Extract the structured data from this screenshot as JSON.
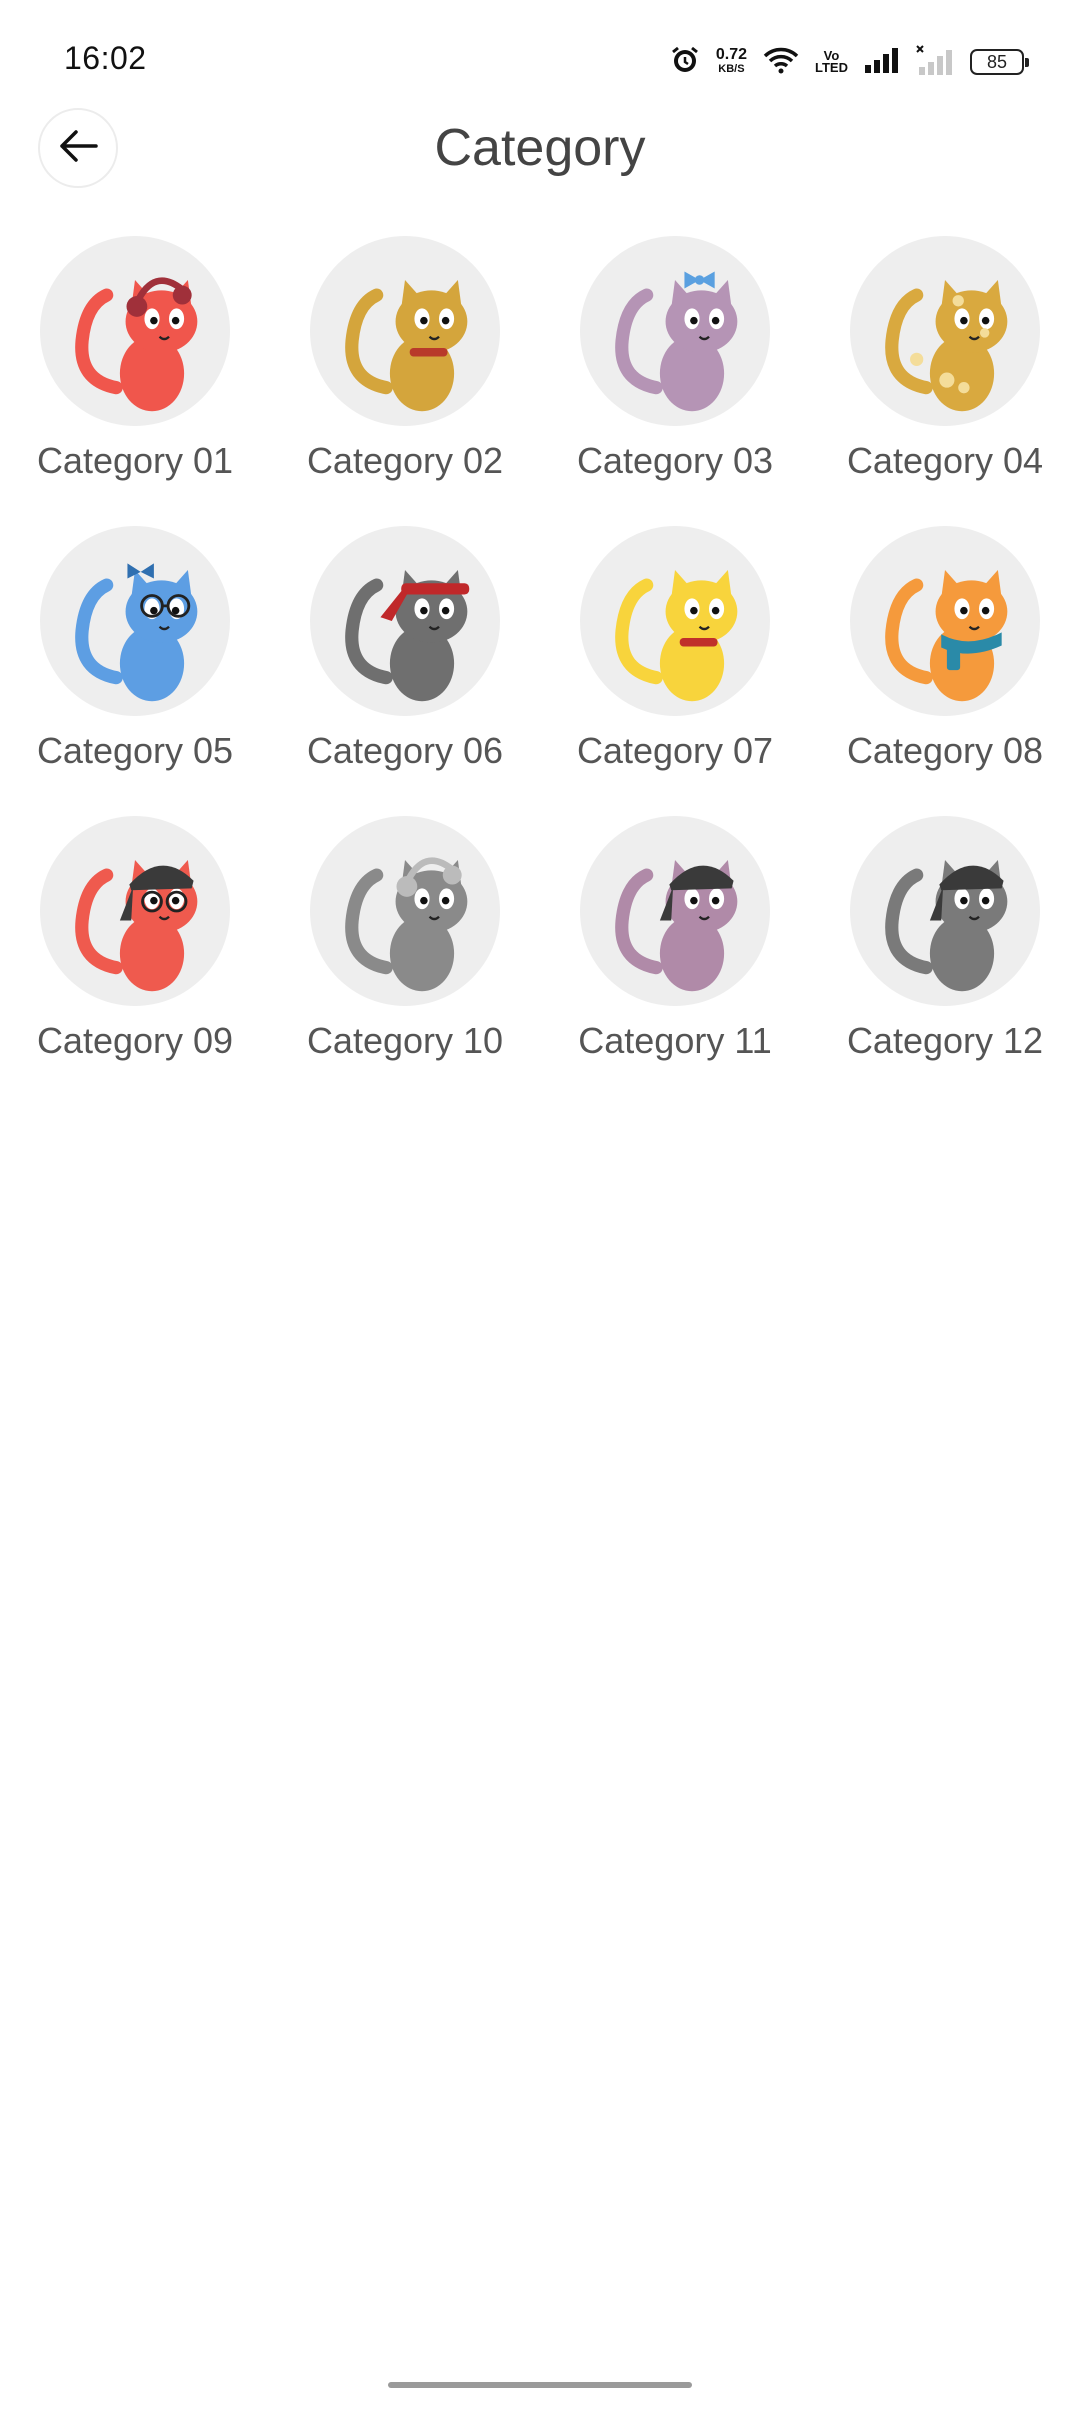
{
  "status_bar": {
    "time": "16:02",
    "net_speed_value": "0.72",
    "net_speed_unit": "KB/S",
    "volte_line1": "Vo",
    "volte_line2": "LTED",
    "battery_level": "85",
    "icons": [
      "alarm-icon",
      "wifi-icon",
      "signal-icon",
      "signal-no-service-icon",
      "battery-icon"
    ]
  },
  "header": {
    "title": "Category",
    "back_icon": "arrow-left-icon"
  },
  "categories": [
    {
      "label": "Category 01",
      "color": "#f0564c",
      "accessory": "headphones",
      "accessory_color": "#a0303a"
    },
    {
      "label": "Category 02",
      "color": "#d4a53c",
      "accessory": "collar",
      "accessory_color": "#b83a2a"
    },
    {
      "label": "Category 03",
      "color": "#b594b5",
      "accessory": "bow",
      "accessory_color": "#5aa0e0"
    },
    {
      "label": "Category 04",
      "color": "#d9a93f",
      "accessory": "spots",
      "accessory_color": "#f4dd9a"
    },
    {
      "label": "Category 05",
      "color": "#5d9ee3",
      "accessory": "glasses-bow",
      "accessory_color": "#2f6fb0"
    },
    {
      "label": "Category 06",
      "color": "#6f6f6f",
      "accessory": "headband",
      "accessory_color": "#c0282a"
    },
    {
      "label": "Category 07",
      "color": "#f8d43c",
      "accessory": "collar",
      "accessory_color": "#c0302a"
    },
    {
      "label": "Category 08",
      "color": "#f59a3c",
      "accessory": "scarf",
      "accessory_color": "#2a8aa8"
    },
    {
      "label": "Category 09",
      "color": "#ef5a4e",
      "accessory": "bandana-glasses",
      "accessory_color": "#3a3a3a"
    },
    {
      "label": "Category 10",
      "color": "#8a8a8a",
      "accessory": "headphones",
      "accessory_color": "#bbbbbb"
    },
    {
      "label": "Category 11",
      "color": "#b08aa8",
      "accessory": "bandana",
      "accessory_color": "#3a3a3a"
    },
    {
      "label": "Category 12",
      "color": "#7a7a7a",
      "accessory": "bandana",
      "accessory_color": "#3a3a3a"
    }
  ]
}
